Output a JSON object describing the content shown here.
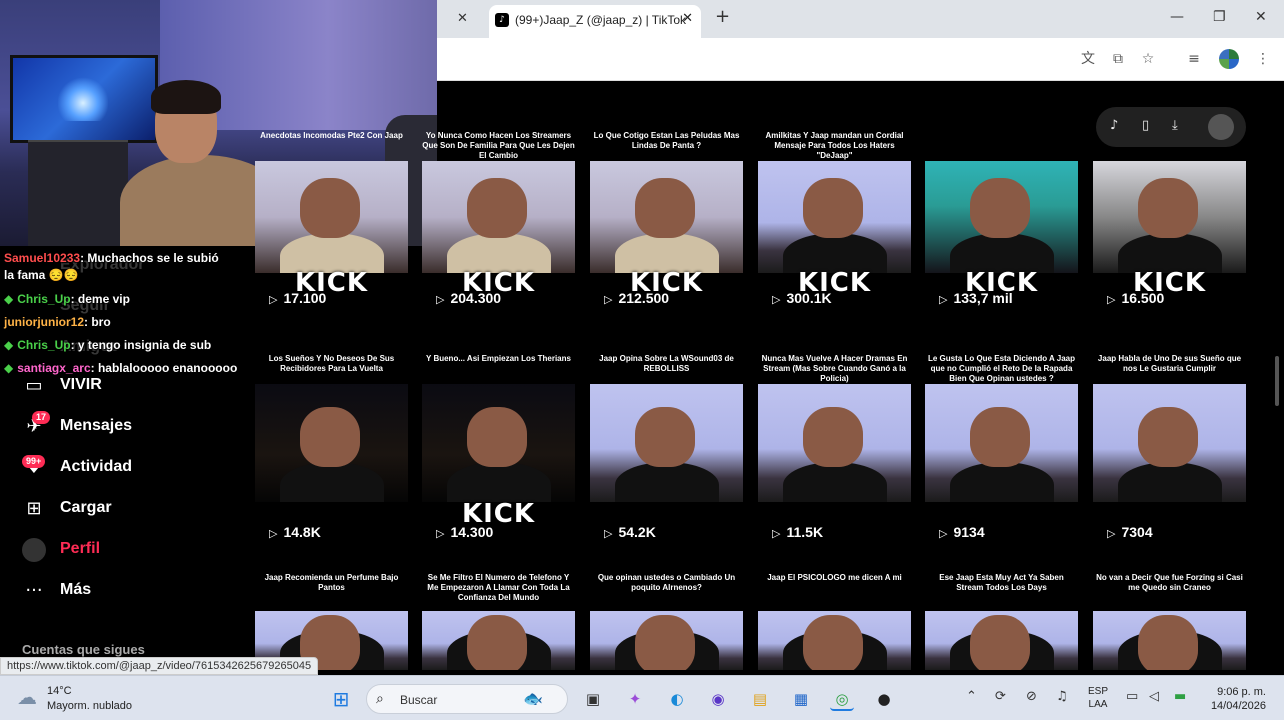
{
  "browser": {
    "tab_title": "(99+)Jaap_Z (@jaap_z) | TikTok",
    "favicon": "tiktok-icon",
    "new_tab": "+",
    "close": "✕",
    "minimize": "—",
    "maximize": "❐",
    "status_url": "https://www.tiktok.com/@jaap_z/video/7615342625679265045"
  },
  "sidebar": {
    "ghost_items": [
      "Explorador",
      "Seguir",
      "Amigos"
    ],
    "items": [
      {
        "label": "VIVIR",
        "icon": "live-icon"
      },
      {
        "label": "Mensajes",
        "icon": "messages-icon",
        "badge": "17"
      },
      {
        "label": "Actividad",
        "icon": "activity-icon",
        "badge": "99+"
      },
      {
        "label": "Cargar",
        "icon": "upload-icon"
      },
      {
        "label": "Perfil",
        "icon": "profile-avatar"
      },
      {
        "label": "Más",
        "icon": "more-icon"
      }
    ],
    "following_title": "Cuentas que sigues"
  },
  "chat": [
    {
      "user": "Samuel10233",
      "text": ": Muchachos se le subió",
      "text2": "la fama 😔😔",
      "color": "#ff4d4d"
    },
    {
      "user": "Chris_Up",
      "text": ": deme vip",
      "color": "#4ad04a",
      "diamond": true
    },
    {
      "user": "juniorjunior12",
      "text": ": bro",
      "color": "#ffb347"
    },
    {
      "user": "Chris_Up",
      "text": ": y tengo insignia de sub",
      "color": "#4ad04a",
      "diamond": true
    },
    {
      "user": "santiagx_arc",
      "text": ": hablalooooo enanooooo",
      "color": "#ff66cc",
      "diamond": true
    }
  ],
  "videos": [
    {
      "caption": "Anecdotas Incomodas Pte2 Con Jaap",
      "views": "17.100",
      "kick": true,
      "bg": "bg-cream",
      "shirt": "cream"
    },
    {
      "caption": "Yo Nunca Como Hacen Los Streamers Que Son De Familia Para Que Les Dejen El Cambio",
      "views": "204.300",
      "kick": true,
      "bg": "bg-cream",
      "shirt": "cream"
    },
    {
      "caption": "Lo Que Cotigo Estan Las Peludas Mas Lindas De Panta ?",
      "views": "212.500",
      "kick": true,
      "bg": "bg-cream",
      "shirt": "cream"
    },
    {
      "caption": "Amilkitas Y Jaap mandan un Cordial Mensaje Para Todos Los Haters \"DeJaap\"",
      "views": "300.1K",
      "kick": true,
      "bg": "bg-room",
      "shirt": "black"
    },
    {
      "caption": "",
      "views": "133,7 mil",
      "kick": true,
      "bg": "bg-teal",
      "shirt": "black"
    },
    {
      "caption": "",
      "views": "16.500",
      "kick": true,
      "bg": "bg-street",
      "shirt": "black"
    },
    {
      "caption": "Los Sueños Y No Deseos De Sus Recibidores Para La Vuelta",
      "views": "14.8K",
      "kick": false,
      "bg": "bg-night",
      "shirt": "black"
    },
    {
      "caption": "Y Bueno... Asi Empiezan Los Therians",
      "views": "14.300",
      "kick": true,
      "bg": "bg-night",
      "shirt": "black"
    },
    {
      "caption": "Jaap Opina Sobre La WSound03 de REBOLLISS",
      "views": "54.2K",
      "kick": false,
      "bg": "bg-room",
      "shirt": "black"
    },
    {
      "caption": "Nunca Mas Vuelve A Hacer Dramas En Stream (Mas Sobre Cuando Ganó a la Policia)",
      "views": "11.5K",
      "kick": false,
      "bg": "bg-room",
      "shirt": "black"
    },
    {
      "caption": "Le Gusta Lo Que Esta Diciendo A Jaap que no Cumplió el Reto De la Rapada Bien Que Opinan ustedes ?",
      "views": "9134",
      "kick": false,
      "bg": "bg-room",
      "shirt": "black"
    },
    {
      "caption": "Jaap Habla de Uno De sus Sueño que nos Le Gustaria Cumplir",
      "views": "7304",
      "kick": false,
      "bg": "bg-room",
      "shirt": "black"
    },
    {
      "caption": "Jaap Recomienda un Perfume Bajo Pantos",
      "views": "",
      "kick": false,
      "bg": "bg-room",
      "shirt": "black"
    },
    {
      "caption": "Se Me Filtro El Numero de Telefono Y Me Empezaron A Llamar Con Toda La Confianza Del Mundo",
      "views": "",
      "kick": false,
      "bg": "bg-room",
      "shirt": "black"
    },
    {
      "caption": "Que opinan ustedes o Cambiado Un poquito Alrnenos?",
      "views": "",
      "kick": false,
      "bg": "bg-room",
      "shirt": "black"
    },
    {
      "caption": "Jaap El PSICOLOGO me dicen A mi",
      "views": "",
      "kick": false,
      "bg": "bg-room",
      "shirt": "black"
    },
    {
      "caption": "Ese Jaap Esta Muy Act Ya Saben Stream Todos Los Days",
      "views": "",
      "kick": false,
      "bg": "bg-room",
      "shirt": "black"
    },
    {
      "caption": "No van a Decir Que fue Forzing si Casi me Quedo sin Craneo",
      "views": "",
      "kick": false,
      "bg": "bg-room",
      "shirt": "black"
    }
  ],
  "kick_label": "KICK",
  "taskbar": {
    "weather_temp": "14°C",
    "weather_desc": "Mayorm. nublado",
    "search_placeholder": "Buscar",
    "lang_top": "ESP",
    "lang_bottom": "LAA",
    "time": "9:06 p. m.",
    "date": "14/04/2026"
  }
}
